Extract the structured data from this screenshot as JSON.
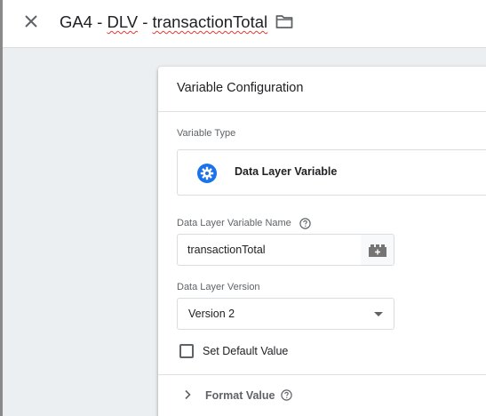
{
  "header": {
    "close_icon": "close-icon",
    "title_prefix": "GA4 - ",
    "title_dlv": "DLV",
    "title_sep": " - ",
    "title_var": "transactionTotal",
    "folder_icon": "folder-icon"
  },
  "card": {
    "title": "Variable Configuration",
    "variable_type": {
      "label": "Variable Type",
      "value": "Data Layer Variable",
      "icon": "gear-icon",
      "icon_color": "#1a73e8"
    },
    "dlv_name": {
      "label": "Data Layer Variable Name",
      "help_icon": "help-icon",
      "value": "transactionTotal",
      "picker_icon": "lego-brick-icon"
    },
    "dlv_version": {
      "label": "Data Layer Version",
      "selected": "Version 2"
    },
    "default_value": {
      "label": "Set Default Value",
      "checked": false
    },
    "format_value": {
      "label": "Format Value",
      "help_icon": "help-icon"
    }
  }
}
